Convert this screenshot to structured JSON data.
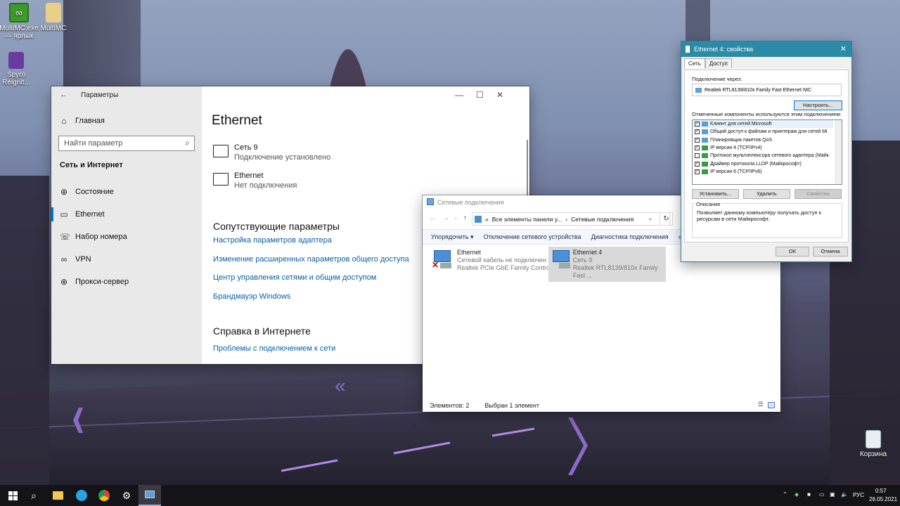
{
  "desktop": {
    "icons": [
      {
        "label": "MultiMC.exe — ярлык",
        "icon": "multimc-icon"
      },
      {
        "label": "MultiMC",
        "icon": "folder-icon"
      },
      {
        "label": "Spyro Reignit...",
        "icon": "spyro-icon"
      },
      {
        "label": "Корзина",
        "icon": "recycle-bin-icon"
      }
    ]
  },
  "settings": {
    "title": "Параметры",
    "home": "Главная",
    "search_placeholder": "Найти параметр",
    "section": "Сеть и Интернет",
    "nav": [
      {
        "label": "Состояние",
        "icon": "status-icon"
      },
      {
        "label": "Ethernet",
        "icon": "ethernet-icon",
        "active": true
      },
      {
        "label": "Набор номера",
        "icon": "dialup-icon"
      },
      {
        "label": "VPN",
        "icon": "vpn-icon"
      },
      {
        "label": "Прокси-сервер",
        "icon": "proxy-icon"
      }
    ],
    "page_title": "Ethernet",
    "connections": [
      {
        "name": "Сеть 9",
        "status": "Подключение установлено"
      },
      {
        "name": "Ethernet",
        "status": "Нет подключения"
      }
    ],
    "related_title": "Сопутствующие параметры",
    "related_links": [
      "Настройка параметров адаптера",
      "Изменение расширенных параметров общего доступа",
      "Центр управления сетями и общим доступом",
      "Брандмауэр Windows"
    ],
    "help_title": "Справка в Интернете",
    "help_links": [
      "Проблемы с подключением к сети"
    ]
  },
  "netconn": {
    "title": "Сетевые подключения",
    "breadcrumb": [
      "«",
      "Все элементы панели у...",
      "›",
      "Сетевые подключения"
    ],
    "commands": [
      "Упорядочить ▾",
      "Отключение сетевого устройства",
      "Диагностика подключения",
      "»"
    ],
    "adapters": [
      {
        "name": "Ethernet",
        "status": "Сетевой кабель не подключен",
        "device": "Realtek PCIe GbE Family Controller",
        "selected": false
      },
      {
        "name": "Ethernet 4",
        "status": "Сеть 9",
        "device": "Realtek RTL8139/810x Family Fast ...",
        "selected": true
      }
    ],
    "status_items": "Элементов: 2",
    "status_selected": "Выбран 1 элемент"
  },
  "props": {
    "title": "Ethernet 4: свойства",
    "tabs": [
      "Сеть",
      "Доступ"
    ],
    "connect_using_label": "Подключение через:",
    "adapter_name": "Realtek RTL8139/810x Family Fast Ethernet NIC",
    "configure_button": "Настроить...",
    "components_label": "Отмеченные компоненты используются этим подключением:",
    "components": [
      {
        "label": "Клиент для сетей Microsoft",
        "checked": true,
        "highlight": true
      },
      {
        "label": "Общий доступ к файлам и принтерам для сетей Mi",
        "checked": true
      },
      {
        "label": "Планировщик пакетов QoS",
        "checked": true
      },
      {
        "label": "IP версии 4 (TCP/IPv4)",
        "checked": true
      },
      {
        "label": "Протокол мультиплексора сетевого адаптера (Майк",
        "checked": false
      },
      {
        "label": "Драйвер протокола LLDP (Майкрософт)",
        "checked": true
      },
      {
        "label": "IP версии 6 (TCP/IPv6)",
        "checked": true
      }
    ],
    "install_button": "Установить...",
    "remove_button": "Удалить",
    "properties_button": "Свойства",
    "description_label": "Описание",
    "description_text": "Позволяет данному компьютеру получать доступ к ресурсам в сети Майкрософт.",
    "ok_button": "ОК",
    "cancel_button": "Отмена"
  },
  "taskbar": {
    "lang": "РУС",
    "time": "0:57",
    "date": "26.05.2021"
  },
  "colors": {
    "accent": "#0078d7",
    "link": "#0a5ea8",
    "props_title": "#2b8aa5"
  }
}
